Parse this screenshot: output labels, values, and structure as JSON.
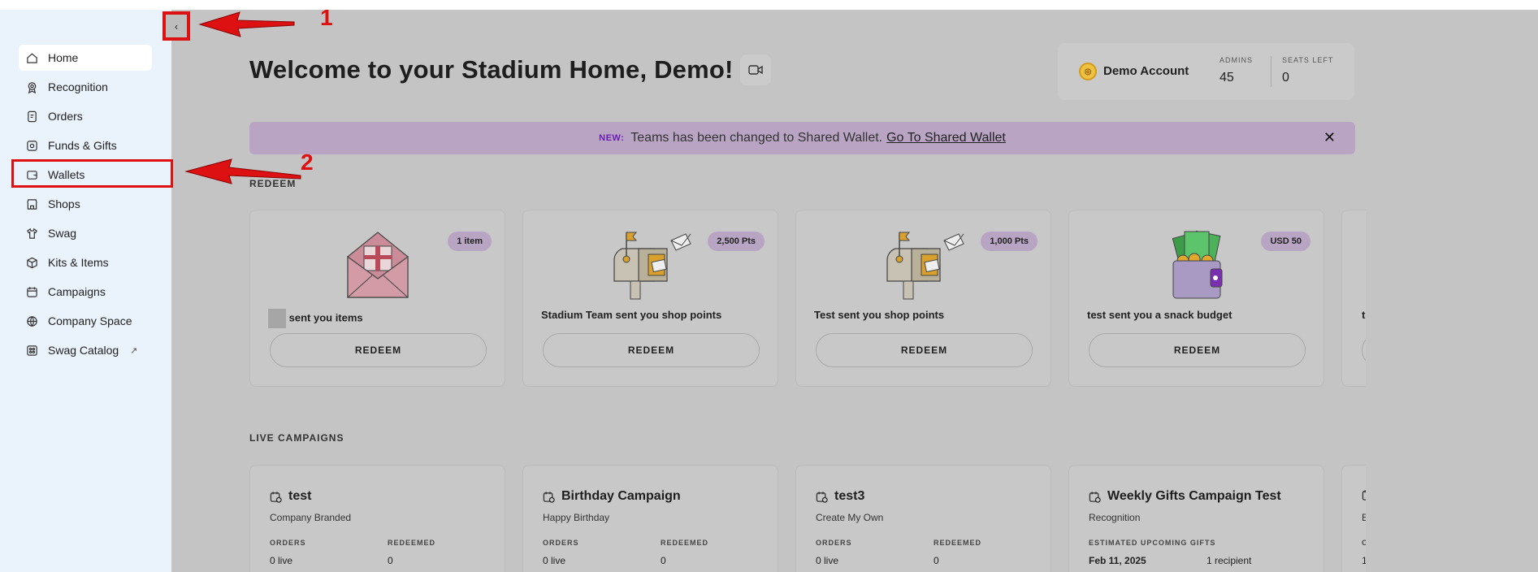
{
  "sidebar": {
    "items": [
      {
        "label": "Home",
        "icon": "home-icon",
        "active": true
      },
      {
        "label": "Recognition",
        "icon": "award-icon"
      },
      {
        "label": "Orders",
        "icon": "receipt-icon"
      },
      {
        "label": "Funds & Gifts",
        "icon": "gift-card-icon"
      },
      {
        "label": "Wallets",
        "icon": "wallet-icon"
      },
      {
        "label": "Shops",
        "icon": "storefront-icon"
      },
      {
        "label": "Swag",
        "icon": "tshirt-icon"
      },
      {
        "label": "Kits & Items",
        "icon": "box-icon"
      },
      {
        "label": "Campaigns",
        "icon": "calendar-icon"
      },
      {
        "label": "Company Space",
        "icon": "globe-icon"
      },
      {
        "label": "Swag Catalog",
        "icon": "catalog-grid-icon",
        "external": "↗"
      }
    ],
    "collapse_glyph": "‹"
  },
  "header": {
    "welcome": "Welcome to your Stadium Home, Demo!"
  },
  "account": {
    "name": "Demo Account",
    "admins_label": "ADMINS",
    "admins_value": "45",
    "seats_label": "SEATS LEFT",
    "seats_value": "0"
  },
  "banner": {
    "new_tag": "NEW:",
    "message": "Teams has been changed to Shared Wallet.",
    "link": "Go To Shared Wallet",
    "close": "✕"
  },
  "redeem": {
    "section_title": "REDEEM",
    "cards": [
      {
        "badge": "1 item",
        "caption": "sent you items",
        "button": "REDEEM",
        "illustration": "envelope-gift"
      },
      {
        "badge": "2,500 Pts",
        "caption": "Stadium Team sent you shop points",
        "button": "REDEEM",
        "illustration": "mailbox"
      },
      {
        "badge": "1,000 Pts",
        "caption": "Test sent you shop points",
        "button": "REDEEM",
        "illustration": "mailbox"
      },
      {
        "badge": "USD 50",
        "caption": "test sent you a snack budget",
        "button": "REDEEM",
        "illustration": "wallet-cash"
      },
      {
        "badge": "",
        "caption": "te",
        "button": "",
        "illustration": ""
      }
    ]
  },
  "campaigns": {
    "section_title": "LIVE CAMPAIGNS",
    "cards": [
      {
        "title": "test",
        "subtitle": "Company Branded",
        "label1": "ORDERS",
        "value1": "0 live",
        "label2": "REDEEMED",
        "value2": "0"
      },
      {
        "title": "Birthday Campaign",
        "subtitle": "Happy Birthday",
        "label1": "ORDERS",
        "value1": "0 live",
        "label2": "REDEEMED",
        "value2": "0"
      },
      {
        "title": "test3",
        "subtitle": "Create My Own",
        "label1": "ORDERS",
        "value1": "0 live",
        "label2": "REDEEMED",
        "value2": "0"
      },
      {
        "title": "Weekly Gifts Campaign Test",
        "subtitle": "Recognition",
        "label1": "ESTIMATED UPCOMING GIFTS",
        "value1": "Feb 11, 2025",
        "label2": "",
        "value2": "1 recipient"
      },
      {
        "title": "",
        "subtitle": "E",
        "label1": "O",
        "value1": "1",
        "label2": "",
        "value2": ""
      }
    ]
  },
  "annotations": {
    "one": "1",
    "two": "2"
  },
  "colors": {
    "overlay": "#c4c4c4",
    "sidebar_bg": "#eaf2fc",
    "banner": "#b9a4c4",
    "annotation_red": "#dd1111"
  }
}
